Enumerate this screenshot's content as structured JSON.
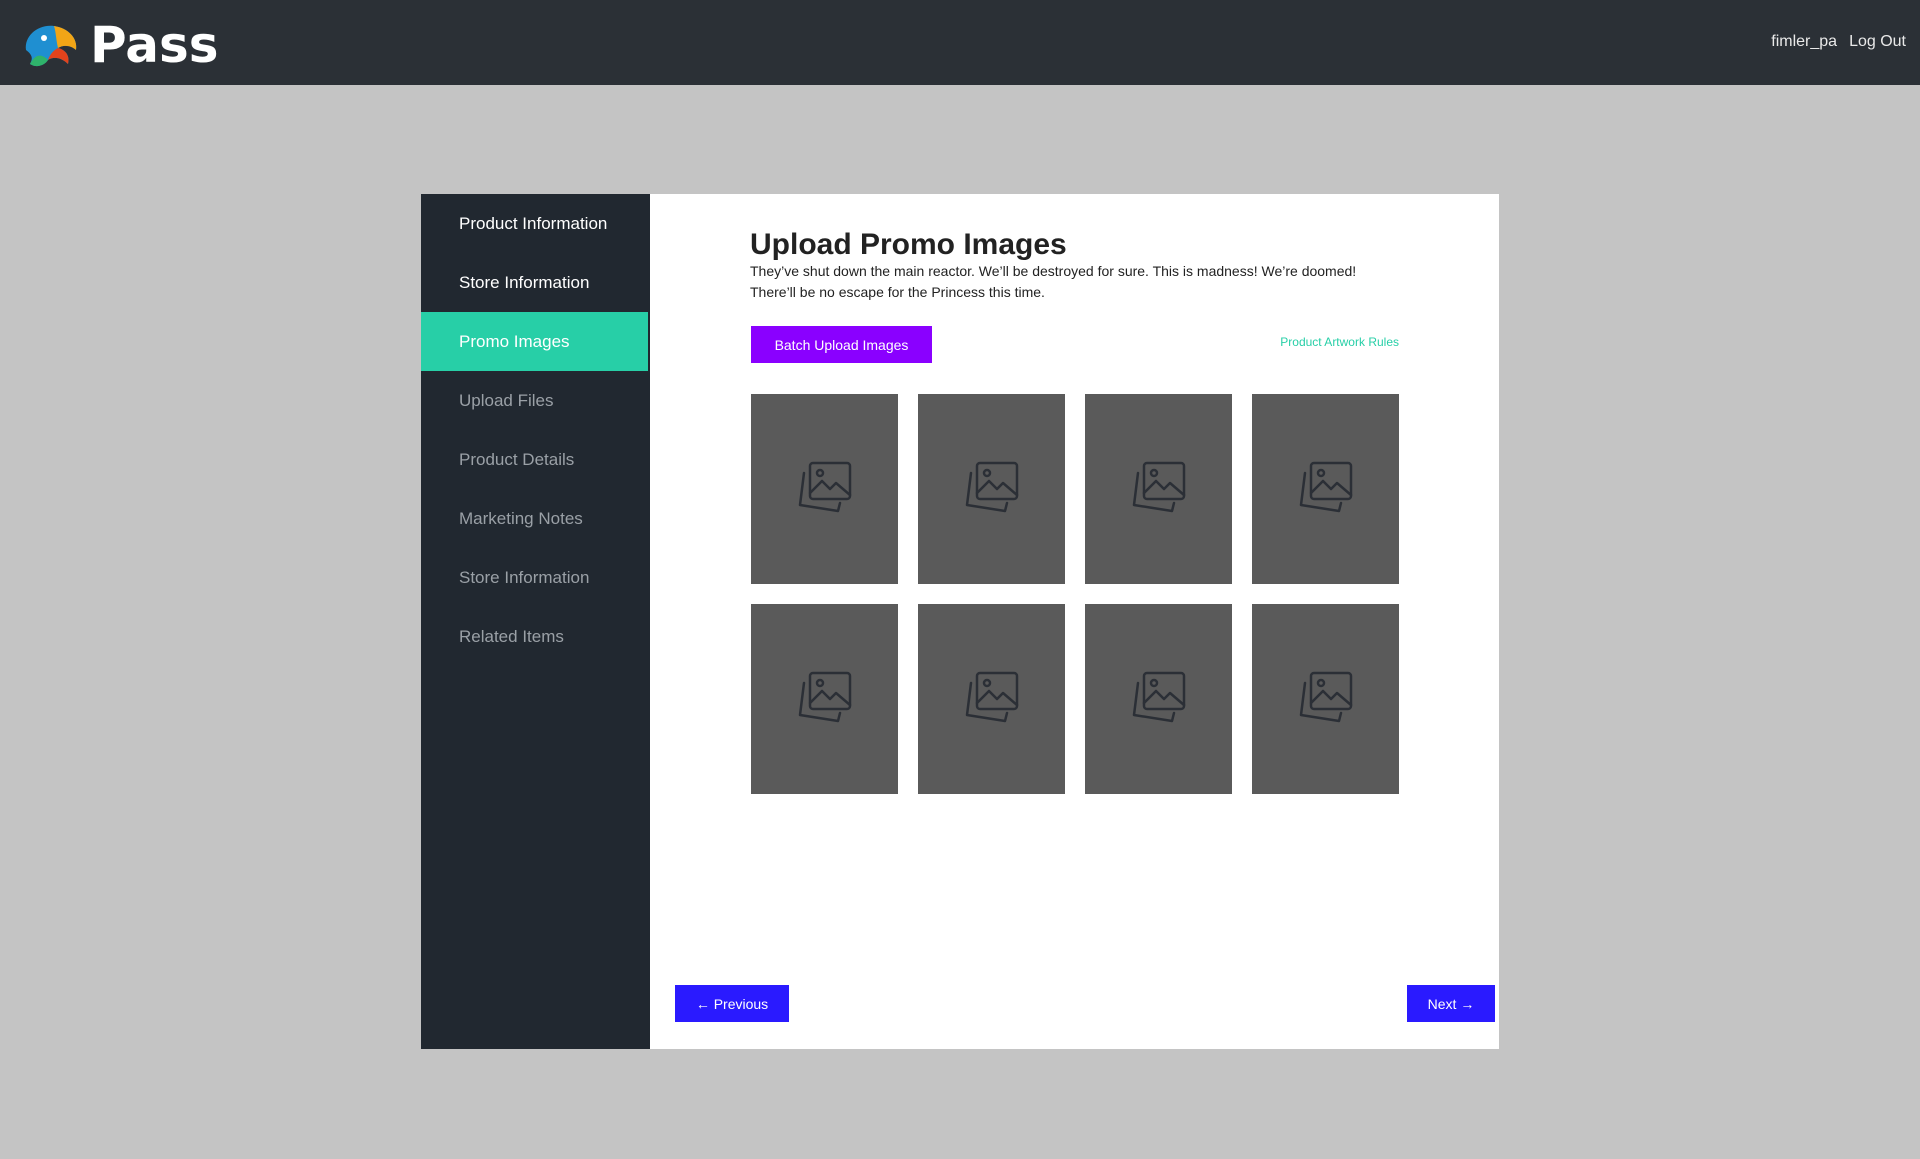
{
  "header": {
    "logo_icon": "parrot-logo-icon",
    "brand": "Pass",
    "username": "fimler_pa",
    "logout_label": "Log Out"
  },
  "sidebar": {
    "items": [
      {
        "label": "Product Information",
        "state": "visited"
      },
      {
        "label": "Store Information",
        "state": "visited"
      },
      {
        "label": "Promo Images",
        "state": "active"
      },
      {
        "label": "Upload Files",
        "state": "pending"
      },
      {
        "label": "Product Details",
        "state": "pending"
      },
      {
        "label": "Marketing Notes",
        "state": "pending"
      },
      {
        "label": "Store Information",
        "state": "pending"
      },
      {
        "label": "Related Items",
        "state": "pending"
      }
    ]
  },
  "main": {
    "title": "Upload Promo Images",
    "description": "They’ve shut down the main reactor. We’ll be destroyed for sure. This is madness! We’re doomed! There’ll be no escape for the Princess this time.",
    "batch_upload_label": "Batch Upload Images",
    "rules_link_label": "Product Artwork Rules",
    "image_slots": 8,
    "slot_icon": "image-placeholder-icon"
  },
  "footer": {
    "previous_label": "← Previous",
    "next_label": "Next →"
  },
  "colors": {
    "topbar": "#2b3036",
    "sidebar": "#212830",
    "accent": "#27cfa7",
    "batch_button": "#8a00ff",
    "nav_button": "#2a1aff",
    "page_bg": "#c4c4c4",
    "slot": "#5a5a5a"
  }
}
